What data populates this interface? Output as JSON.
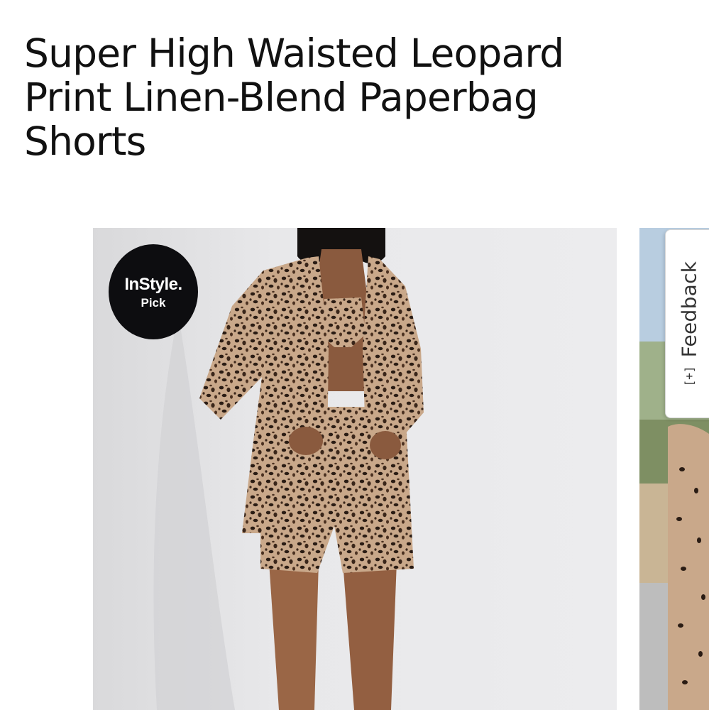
{
  "product": {
    "title": "Super High Waisted Leopard Print Linen-Blend Paperbag Shorts"
  },
  "badge": {
    "brand": "InStyle.",
    "sub": "Pick"
  },
  "feedback": {
    "icon": "[+]",
    "label": "Feedback"
  },
  "colors": {
    "text": "#111111",
    "badge_bg": "#0d0d10",
    "photo_bg": "#e9e9e9"
  }
}
